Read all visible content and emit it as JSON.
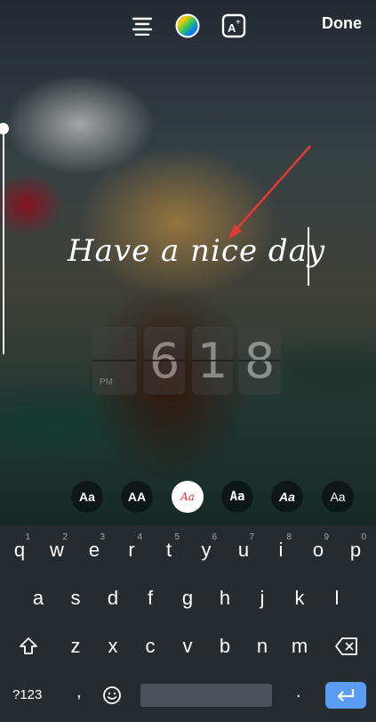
{
  "topbar": {
    "done_label": "Done",
    "icons": [
      "align-icon",
      "color-wheel-icon",
      "text-effect-icon"
    ]
  },
  "story": {
    "text": "Have a nice day",
    "clock": {
      "digits": [
        "6",
        "1",
        "8"
      ],
      "period": "PM"
    }
  },
  "fonts": {
    "items": [
      {
        "label": "Aa"
      },
      {
        "label": "AA"
      },
      {
        "label": "Aa",
        "selected": true
      },
      {
        "label": "Aa"
      },
      {
        "label": "Aa"
      },
      {
        "label": "Aa"
      }
    ]
  },
  "keyboard": {
    "row1": [
      {
        "key": "q",
        "hint": "1"
      },
      {
        "key": "w",
        "hint": "2"
      },
      {
        "key": "e",
        "hint": "3"
      },
      {
        "key": "r",
        "hint": "4"
      },
      {
        "key": "t",
        "hint": "5"
      },
      {
        "key": "y",
        "hint": "6"
      },
      {
        "key": "u",
        "hint": "7"
      },
      {
        "key": "i",
        "hint": "8"
      },
      {
        "key": "o",
        "hint": "9"
      },
      {
        "key": "p",
        "hint": "0"
      }
    ],
    "row2": [
      "a",
      "s",
      "d",
      "f",
      "g",
      "h",
      "j",
      "k",
      "l"
    ],
    "row3": [
      "z",
      "x",
      "c",
      "v",
      "b",
      "n",
      "m"
    ],
    "symbols_label": "?123",
    "comma": ",",
    "period": ".",
    "accent_color": "#5b9cf3"
  }
}
